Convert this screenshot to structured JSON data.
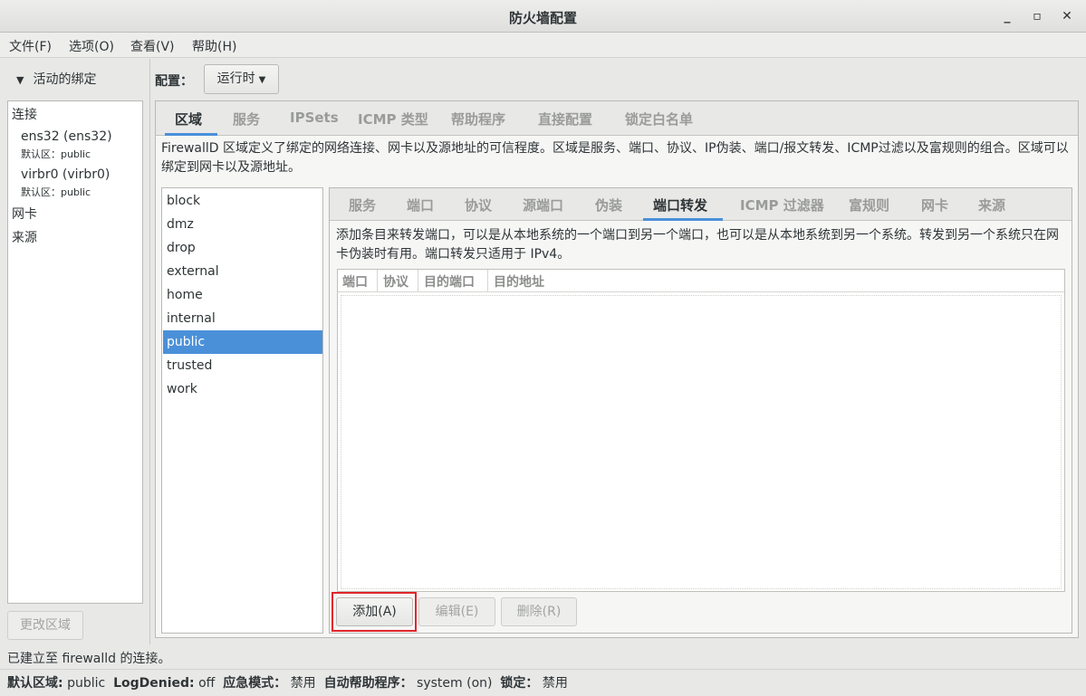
{
  "window": {
    "title": "防火墙配置",
    "minimize": "_",
    "maximize": "▫",
    "close": "✕"
  },
  "menu": [
    "文件(F)",
    "选项(O)",
    "查看(V)",
    "帮助(H)"
  ],
  "bindings": {
    "header": "活动的绑定",
    "connections_label": "连接",
    "connections": [
      {
        "name": "ens32 (ens32)",
        "zone": "默认区：public"
      },
      {
        "name": "virbr0 (virbr0)",
        "zone": "默认区：public"
      }
    ],
    "interfaces_label": "网卡",
    "sources_label": "来源",
    "change_zone_button": "更改区域"
  },
  "config": {
    "label": "配置：",
    "value": "运行时"
  },
  "main_tabs": [
    "区域",
    "服务",
    "IPSets",
    "ICMP 类型",
    "帮助程序",
    "直接配置",
    "锁定白名单"
  ],
  "zone_description": "FirewallD 区域定义了绑定的网络连接、网卡以及源地址的可信程度。区域是服务、端口、协议、IP伪装、端口/报文转发、ICMP过滤以及富规则的组合。区域可以绑定到网卡以及源地址。",
  "zones": [
    "block",
    "dmz",
    "drop",
    "external",
    "home",
    "internal",
    "public",
    "trusted",
    "work"
  ],
  "selected_zone": "public",
  "sub_tabs": [
    "服务",
    "端口",
    "协议",
    "源端口",
    "伪装",
    "端口转发",
    "ICMP 过滤器",
    "富规则",
    "网卡",
    "来源"
  ],
  "active_sub_tab": "端口转发",
  "forward_description": "添加条目来转发端口，可以是从本地系统的一个端口到另一个端口，也可以是从本地系统到另一个系统。转发到另一个系统只在网卡伪装时有用。端口转发只适用于 IPv4。",
  "table_columns": [
    "端口",
    "协议",
    "目的端口",
    "目的地址"
  ],
  "buttons": {
    "add": "添加(A)",
    "edit": "编辑(E)",
    "delete": "删除(R)"
  },
  "status": {
    "connection": "已建立至  firewalld 的连接。",
    "default_zone_label": "默认区域:",
    "default_zone": "public",
    "log_denied_label": "LogDenied:",
    "log_denied": "off",
    "panic_label": "应急模式：",
    "panic": "禁用",
    "helpers_label": "自动帮助程序：",
    "helpers": "system (on)",
    "lockdown_label": "锁定：",
    "lockdown": "禁用"
  },
  "colors": {
    "accent": "#4a90d9",
    "highlight": "#e0262a"
  }
}
